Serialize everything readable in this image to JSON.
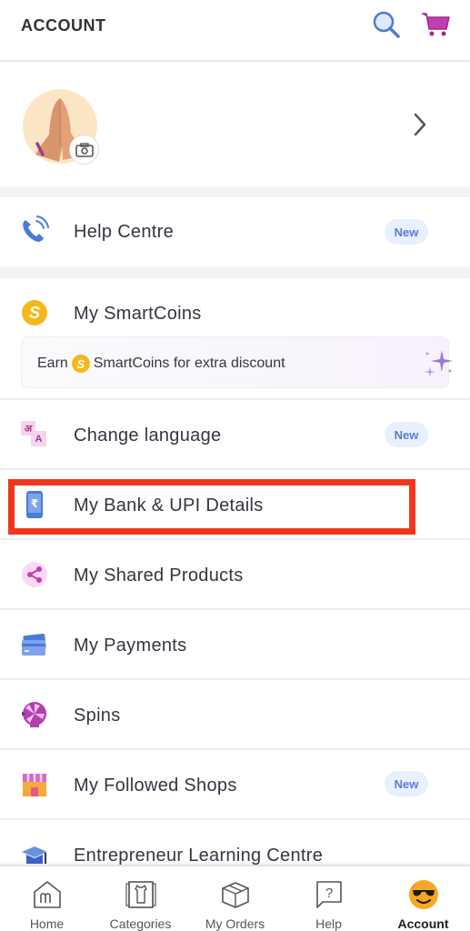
{
  "header": {
    "title": "ACCOUNT",
    "search_icon": "search-icon",
    "cart_icon": "cart-icon"
  },
  "profile": {
    "avatar_icon": "namaste-avatar",
    "camera_icon": "camera-icon",
    "chevron_icon": "chevron-right-icon"
  },
  "menu": {
    "help_centre": {
      "label": "Help Centre",
      "badge": "New",
      "icon": "phone-call-icon"
    },
    "smartcoins": {
      "label": "My SmartCoins",
      "icon": "smartcoin-icon",
      "coin_glyph": "S",
      "promo": {
        "prefix": "Earn",
        "suffix": "SmartCoins for extra discount",
        "icon": "sparkle-icon"
      }
    },
    "change_language": {
      "label": "Change language",
      "badge": "New",
      "icon": "language-icon",
      "glyph_hindi": "अ",
      "glyph_latin": "A"
    },
    "bank_upi": {
      "label": "My Bank & UPI Details",
      "icon": "bank-upi-icon",
      "glyph": "₹"
    },
    "shared_products": {
      "label": "My Shared Products",
      "icon": "share-icon"
    },
    "payments": {
      "label": "My Payments",
      "icon": "payment-cards-icon"
    },
    "spins": {
      "label": "Spins",
      "icon": "spin-wheel-icon"
    },
    "followed_shops": {
      "label": "My Followed Shops",
      "badge": "New",
      "icon": "shop-icon"
    },
    "learning_centre": {
      "label": "Entrepreneur Learning Centre",
      "icon": "graduation-cap-icon"
    }
  },
  "bottom_nav": {
    "items": [
      {
        "label": "Home",
        "icon": "home-icon",
        "active": false
      },
      {
        "label": "Categories",
        "icon": "categories-icon",
        "active": false
      },
      {
        "label": "My Orders",
        "icon": "orders-box-icon",
        "active": false
      },
      {
        "label": "Help",
        "icon": "help-icon",
        "active": false
      },
      {
        "label": "Account",
        "icon": "account-avatar-icon",
        "active": true
      }
    ]
  },
  "colors": {
    "highlight": "#f0361c",
    "badge_bg": "#e8effd",
    "badge_text": "#5a7bd6",
    "coin": "#f5b81c",
    "cart": "#c23fb1",
    "search": "#4b7bd8"
  }
}
